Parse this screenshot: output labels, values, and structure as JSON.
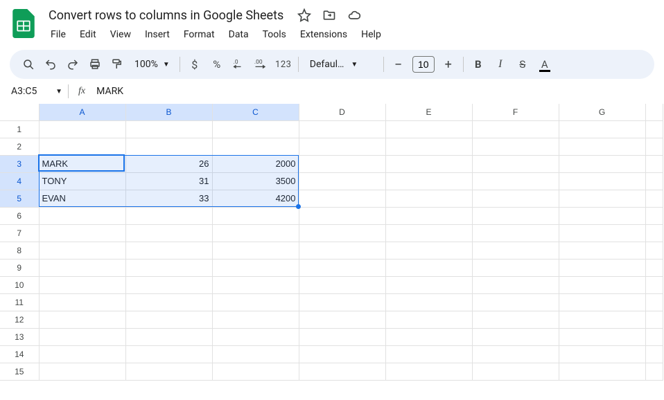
{
  "header": {
    "doc_title": "Convert rows to columns in Google Sheets",
    "menus": [
      "File",
      "Edit",
      "View",
      "Insert",
      "Format",
      "Data",
      "Tools",
      "Extensions",
      "Help"
    ]
  },
  "toolbar": {
    "zoom": "100%",
    "font_name": "Defaul…",
    "font_size": "10",
    "number_label": "123"
  },
  "name_box": {
    "ref": "A3:C5",
    "fx_label": "fx",
    "formula_text": "MARK"
  },
  "columns": [
    "A",
    "B",
    "C",
    "D",
    "E",
    "F",
    "G"
  ],
  "selected_columns": [
    "A",
    "B",
    "C"
  ],
  "row_count": 15,
  "selected_rows": [
    3,
    4,
    5
  ],
  "cells": {
    "r3": {
      "A": "MARK",
      "B": "26",
      "C": "2000"
    },
    "r4": {
      "A": "TONY",
      "B": "31",
      "C": "3500"
    },
    "r5": {
      "A": "EVAN",
      "B": "33",
      "C": "4200"
    }
  },
  "selection": {
    "top_row": 3,
    "bottom_row": 5,
    "left_col": "A",
    "right_col": "C",
    "active_cell": "A3"
  }
}
